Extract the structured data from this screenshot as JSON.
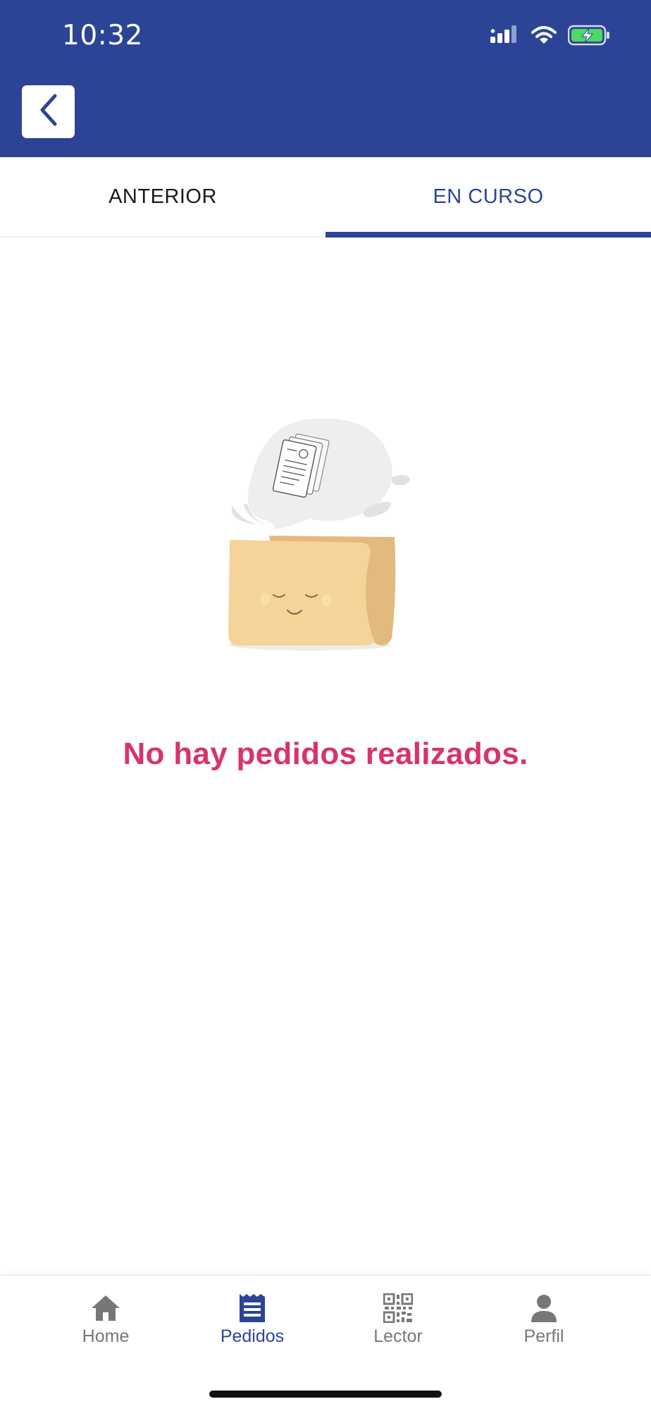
{
  "status_bar": {
    "time": "10:32",
    "icons": [
      "signal-icon",
      "wifi-icon",
      "battery-charging-icon"
    ]
  },
  "header": {
    "back_icon": "chevron-left-icon"
  },
  "tabs": [
    {
      "label": "ANTERIOR",
      "active": false
    },
    {
      "label": "EN CURSO",
      "active": true
    }
  ],
  "empty_state": {
    "illustration": "sleeping-folder-with-document-illustration",
    "message": "No hay pedidos realizados."
  },
  "bottom_nav": {
    "items": [
      {
        "label": "Home",
        "icon": "home-icon",
        "active": false
      },
      {
        "label": "Pedidos",
        "icon": "orders-icon",
        "active": true
      },
      {
        "label": "Lector",
        "icon": "qr-code-icon",
        "active": false
      },
      {
        "label": "Perfil",
        "icon": "user-icon",
        "active": false
      }
    ]
  },
  "colors": {
    "primary": "#2b4496",
    "accent_message": "#d8336b",
    "inactive_nav": "#777777",
    "folder": "#f5d49a"
  }
}
